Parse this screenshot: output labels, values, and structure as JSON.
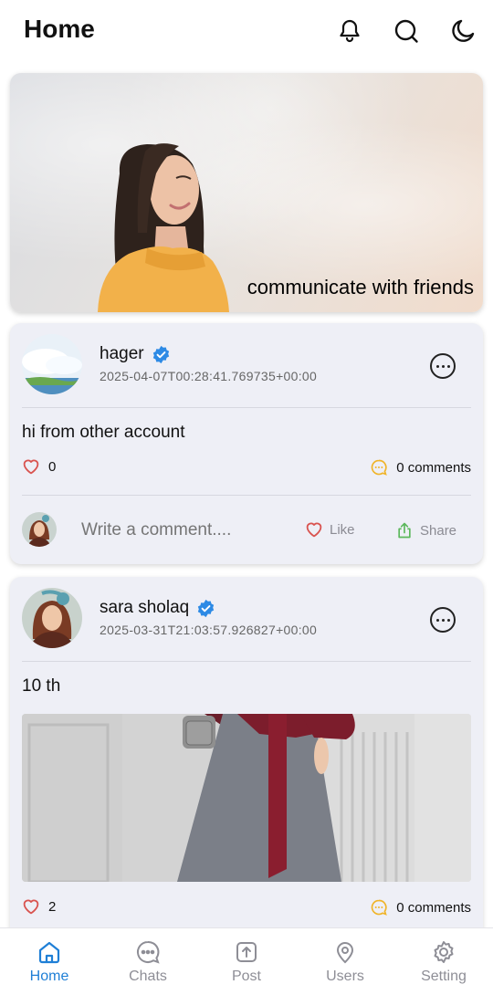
{
  "app": {
    "title": "Home"
  },
  "appbar": {
    "icons": [
      "bell-icon",
      "search-icon",
      "moon-icon"
    ]
  },
  "hero": {
    "caption": "communicate with friends"
  },
  "posts": [
    {
      "author": "hager",
      "verified": true,
      "timestamp": "2025-04-07T00:28:41.769735+00:00",
      "text": "hi from other account",
      "likes": "0",
      "comments": "0 comments",
      "comment_placeholder": "Write a comment....",
      "like_label": "Like",
      "share_label": "Share"
    },
    {
      "author": "sara sholaq",
      "verified": true,
      "timestamp": "2025-03-31T21:03:57.926827+00:00",
      "text": "10 th",
      "likes": "2",
      "comments": "0 comments"
    }
  ],
  "nav": {
    "items": [
      {
        "label": "Home",
        "icon": "home-icon",
        "active": true
      },
      {
        "label": "Chats",
        "icon": "chat-icon",
        "active": false
      },
      {
        "label": "Post",
        "icon": "upload-icon",
        "active": false
      },
      {
        "label": "Users",
        "icon": "location-pin-icon",
        "active": false
      },
      {
        "label": "Setting",
        "icon": "gear-icon",
        "active": false
      }
    ]
  },
  "colors": {
    "accent": "#1f7fd6",
    "verified": "#2d8ae5",
    "heart": "#d9534f",
    "comment": "#f0b429",
    "share": "#5cb85c",
    "card_bg": "#eeeff6"
  }
}
